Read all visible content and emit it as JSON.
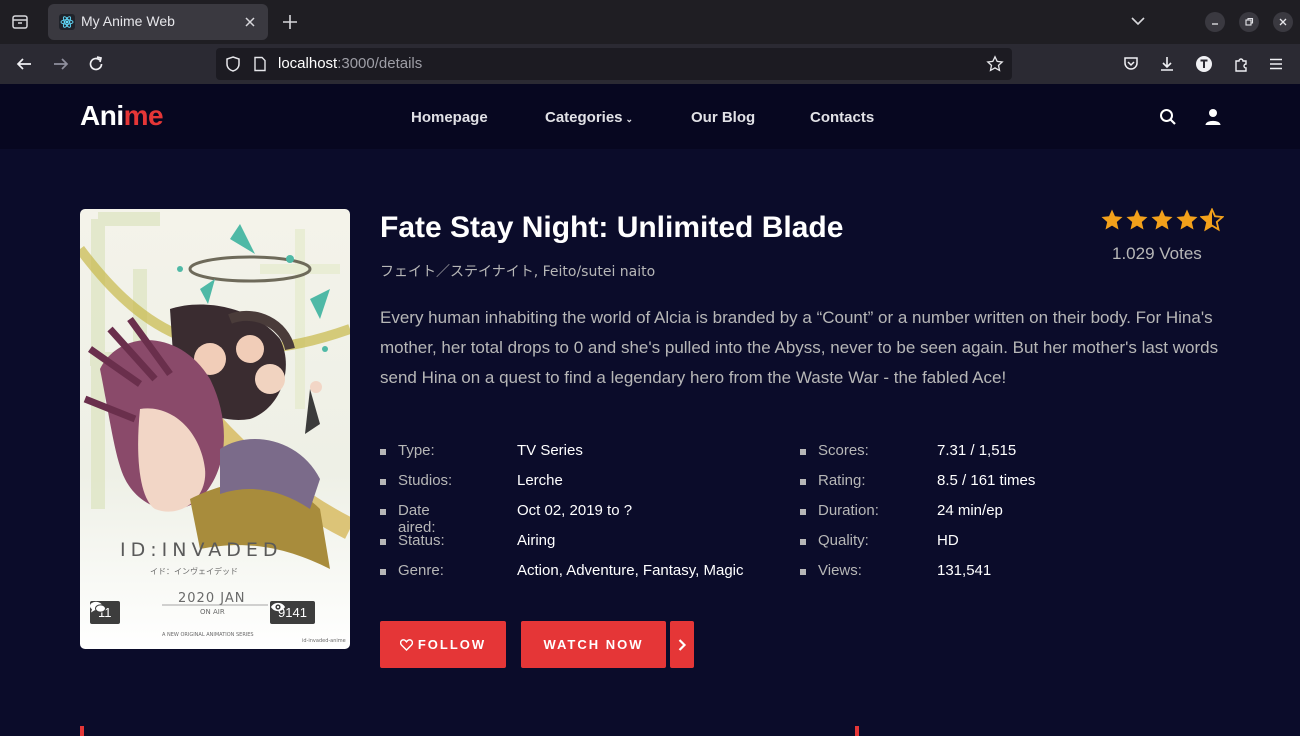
{
  "browser": {
    "tab_title": "My Anime Web",
    "url_host": "localhost",
    "url_path": ":3000/details"
  },
  "site": {
    "logo_part1": "Ani",
    "logo_part2": "me",
    "menu": [
      {
        "label": "Homepage"
      },
      {
        "label": "Categories"
      },
      {
        "label": "Our Blog"
      },
      {
        "label": "Contacts"
      }
    ],
    "categories_caret": "⌄"
  },
  "anime": {
    "title": "Fate Stay Night: Unlimited Blade",
    "subtitle": "フェイト／ステイナイト, Feito/sutei naito",
    "rating_stars": 4.5,
    "votes": "1.029 Votes",
    "description": "Every human inhabiting the world of Alcia is branded by a “Count” or a number written on their body. For Hina's mother, her total drops to 0 and she's pulled into the Abyss, never to be seen again. But her mother's last words send Hina on a quest to find a legendary hero from the Waste War - the fabled Ace!",
    "poster": {
      "comments": "11",
      "views": "9141",
      "poster_text_title": "ID:INVADED",
      "poster_text_sub": "イド：インヴェイデッド",
      "poster_date": "2020 JAN",
      "poster_onair": "ON AIR",
      "poster_footer": "A NEW ORIGINAL ANIMATION SERIES",
      "poster_handle": "id-invaded-anime"
    },
    "info_left": [
      {
        "label": "Type:",
        "value": "TV Series"
      },
      {
        "label": "Studios:",
        "value": "Lerche"
      },
      {
        "label": "Date aired:",
        "value": "Oct 02, 2019 to ?"
      },
      {
        "label": "Status:",
        "value": "Airing"
      },
      {
        "label": "Genre:",
        "value": "Action, Adventure, Fantasy, Magic"
      }
    ],
    "info_right": [
      {
        "label": "Scores:",
        "value": "7.31 / 1,515"
      },
      {
        "label": "Rating:",
        "value": "8.5 / 161 times"
      },
      {
        "label": "Duration:",
        "value": "24 min/ep"
      },
      {
        "label": "Quality:",
        "value": "HD"
      },
      {
        "label": "Views:",
        "value": "131,541"
      }
    ],
    "follow_label": "FOLLOW",
    "watch_label": "WATCH NOW"
  },
  "colors": {
    "accent": "#e53637",
    "page_bg": "#0b0c2a",
    "header_bg": "#070720",
    "star": "#f3a11b"
  }
}
